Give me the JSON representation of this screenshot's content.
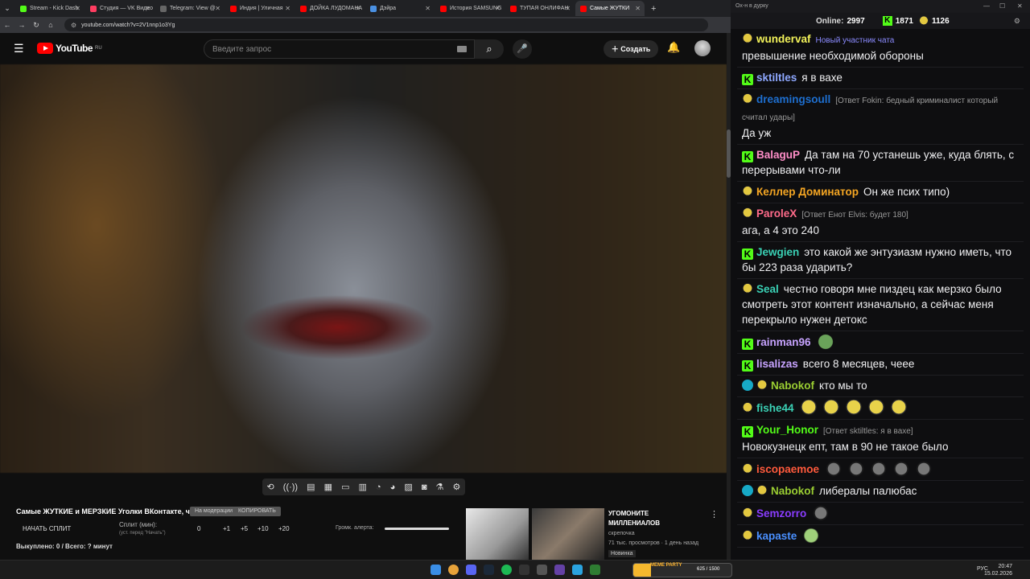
{
  "browser": {
    "tabs": [
      {
        "label": "Stream - Kick Dash",
        "color": "#53fc18"
      },
      {
        "label": "Студия — VK Видео",
        "color": "#ff3d61"
      },
      {
        "label": "Telegram: View @",
        "color": "#666666"
      },
      {
        "label": "Индия | Уличная",
        "color": "#ff0000"
      },
      {
        "label": "ДОЙКА ЛУДОМАНА",
        "color": "#ff0000"
      },
      {
        "label": "Дэйра",
        "color": "#4a90e2"
      },
      {
        "label": "История SAMSUNG",
        "color": "#ff0000"
      },
      {
        "label": "ТУПАЯ ОНЛИФАН",
        "color": "#ff0000"
      },
      {
        "label": "Самые ЖУТКИ",
        "color": "#ff0000"
      }
    ],
    "new_tab": "+",
    "url": "youtube.com/watch?v=2V1nnp1o3Yg"
  },
  "youtube": {
    "logo_text": "YouTube",
    "logo_region": "RU",
    "search_placeholder": "Введите запрос",
    "create_label": "Создать",
    "video_title": "Самые ЖУТКИЕ и МЕРЗКИЕ Уголки ВКонтакте, ч.4",
    "chip1": "На модерации",
    "chip2": "КОПИРОВАТЬ",
    "split_button": "НАЧАТЬ СПЛИТ",
    "split_label": "Сплит (мин):",
    "split_hint": "(уст. перед \"Начать\")",
    "split_values": [
      "0",
      "+1",
      "+5",
      "+10",
      "+20"
    ],
    "alert_label": "Громк. алерта:",
    "alert_level": 1.0,
    "totals": "Выкуплено: 0 / Всего: ? минут",
    "rec_title": "УГОМОНИТЕ МИЛЛЕНИАЛОВ",
    "rec_channel": "скрепочка",
    "rec_meta": "71 тыс. просмотров · 1 день назад",
    "rec_badge": "Новинка"
  },
  "chat": {
    "window_title": "Ох-н в дурку",
    "online_label": "Online:",
    "online_value": "2997",
    "kick_count": "1871",
    "other_count": "1126",
    "messages": [
      {
        "badge": "p",
        "user": "wundervaf",
        "color": "#f3f35a",
        "tag": "Новый участник чата",
        "reply": "",
        "text": "превышение необходимой обороны",
        "emotes": []
      },
      {
        "badge": "k",
        "user": "sktiltles",
        "color": "#8ea8ff",
        "tag": "",
        "reply": "",
        "text": "я в вахе",
        "emotes": []
      },
      {
        "badge": "p",
        "user": "dreamingsoull",
        "color": "#1e6fd0",
        "tag": "",
        "reply": "[Ответ Fokin: бедный криминалист который считал удары]",
        "text": "Да уж",
        "emotes": []
      },
      {
        "badge": "k",
        "user": "BalaguP",
        "color": "#ff8ec8",
        "tag": "",
        "reply": "",
        "text": "Да там на 70 устанешь уже, куда блять, с перерывами что-ли",
        "emotes": []
      },
      {
        "badge": "p",
        "user": "Келлер Доминатор",
        "color": "#f5a623",
        "tag": "",
        "reply": "",
        "text": "Он же псих типо)",
        "emotes": []
      },
      {
        "badge": "p",
        "user": "ParoleX",
        "color": "#ff6b8a",
        "tag": "",
        "reply": "[Ответ Енот Elvis: будет 180]",
        "text": "ага, а 4 это 240",
        "emotes": []
      },
      {
        "badge": "k",
        "user": "Jewgien",
        "color": "#3ad1b5",
        "tag": "",
        "reply": "",
        "text": "это какой же энтузиазм нужно иметь, что бы 223 раза ударить?",
        "emotes": []
      },
      {
        "badge": "p",
        "user": "Seal",
        "color": "#3ad1b5",
        "tag": "",
        "reply": "",
        "text": "честно говоря мне пиздец как мерзко было смотреть этот контент изначально, а сейчас меня перекрыло нужен детокс",
        "emotes": []
      },
      {
        "badge": "k",
        "user": "rainman96",
        "color": "#c7a3ff",
        "tag": "",
        "reply": "",
        "text": "",
        "emotes": [
          "pepe"
        ]
      },
      {
        "badge": "k",
        "user": "lisalizas",
        "color": "#c7a3ff",
        "tag": "",
        "reply": "",
        "text": "всего 8 месяцев, чеее",
        "emotes": []
      },
      {
        "badge": "vp",
        "user": "Nabokof",
        "color": "#9acd32",
        "tag": "",
        "reply": "",
        "text": "кто мы то",
        "emotes": []
      },
      {
        "badge": "p",
        "user": "fishe44",
        "color": "#3ad1b5",
        "tag": "",
        "reply": "",
        "text": "",
        "emotes": [
          "yel",
          "yel",
          "yel",
          "yel",
          "yel"
        ]
      },
      {
        "badge": "k",
        "user": "Your_Honor",
        "color": "#53fc18",
        "tag": "",
        "reply": "[Ответ sktiltles: я в вахе]",
        "text": "Новокузнецк епт, там в 90 не такое было",
        "emotes": []
      },
      {
        "badge": "p",
        "user": "iscopaemoe",
        "color": "#ff5a3c",
        "tag": "",
        "reply": "",
        "text": "",
        "emotes": [
          "cat",
          "cat",
          "cat",
          "cat",
          "cat"
        ]
      },
      {
        "badge": "vp",
        "user": "Nabokof",
        "color": "#9acd32",
        "tag": "",
        "reply": "",
        "text": "либералы палюбас",
        "emotes": []
      },
      {
        "badge": "p",
        "user": "Semzorro",
        "color": "#8a3cff",
        "tag": "",
        "reply": "",
        "text": "",
        "emotes": [
          "cat"
        ]
      },
      {
        "badge": "p",
        "user": "kapaste",
        "color": "#4a90ff",
        "tag": "",
        "reply": "",
        "text": "",
        "emotes": [
          "frog"
        ]
      }
    ]
  },
  "taskbar": {
    "party_name": "MEME PARTY",
    "party_value": "625 / 1500",
    "lang": "РУС",
    "time": "20:47",
    "date": "15.02.2026"
  }
}
